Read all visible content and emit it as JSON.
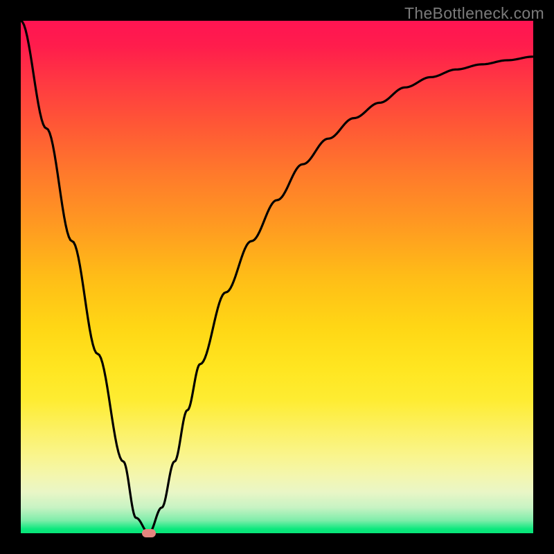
{
  "watermark": "TheBottleneck.com",
  "chart_data": {
    "type": "line",
    "title": "",
    "xlabel": "",
    "ylabel": "",
    "xlim": [
      0,
      100
    ],
    "ylim": [
      0,
      100
    ],
    "grid": false,
    "colors": {
      "top": "#ff1452",
      "bottom": "#08e579",
      "curve": "#000000",
      "marker": "#e5857f"
    },
    "series": [
      {
        "name": "bottleneck-curve",
        "x": [
          0,
          5,
          10,
          15,
          20,
          22.5,
          25,
          27.5,
          30,
          32.5,
          35,
          40,
          45,
          50,
          55,
          60,
          65,
          70,
          75,
          80,
          85,
          90,
          95,
          100
        ],
        "values": [
          100,
          79,
          57,
          35,
          14,
          3,
          0,
          5,
          14,
          24,
          33,
          47,
          57,
          65,
          72,
          77,
          81,
          84,
          87,
          89,
          90.5,
          91.5,
          92.3,
          93
        ]
      }
    ],
    "marker": {
      "x": 25,
      "y": 0
    }
  }
}
